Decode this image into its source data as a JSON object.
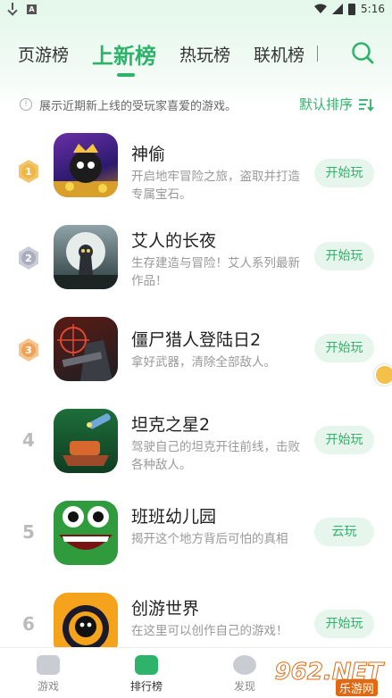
{
  "status_bar": {
    "time": "5:16"
  },
  "tabs": [
    {
      "label": "页游榜"
    },
    {
      "label": "上新榜"
    },
    {
      "label": "热玩榜"
    },
    {
      "label": "联机榜"
    }
  ],
  "info": {
    "text": "展示近期新上线的受玩家喜爱的游戏。",
    "sort_label": "默认排序"
  },
  "games": [
    {
      "rank": "1",
      "title": "神偷",
      "desc": "开启地牢冒险之旅，盗取并打造专属宝石。",
      "button": "开始玩"
    },
    {
      "rank": "2",
      "title": "艾人的长夜",
      "desc": "生存建造与冒险！艾人系列最新作品！",
      "button": "开始玩"
    },
    {
      "rank": "3",
      "title": "僵尸猎人登陆日2",
      "desc": "拿好武器，清除全部敌人。",
      "button": "开始玩"
    },
    {
      "rank": "4",
      "title": "坦克之星2",
      "desc": "驾驶自己的坦克开往前线，击败各种敌人。",
      "button": "开始玩"
    },
    {
      "rank": "5",
      "title": "班班幼儿园",
      "desc": "揭开这个地方背后可怕的真相",
      "button": "云玩"
    },
    {
      "rank": "6",
      "title": "创游世界",
      "desc": "在这里可以创作自己的游戏！",
      "button": "开始玩"
    }
  ],
  "bottom_nav": [
    {
      "label": "游戏"
    },
    {
      "label": "排行榜"
    },
    {
      "label": "发现"
    }
  ],
  "watermark": {
    "big": "962.NET",
    "small": "乐游网"
  }
}
